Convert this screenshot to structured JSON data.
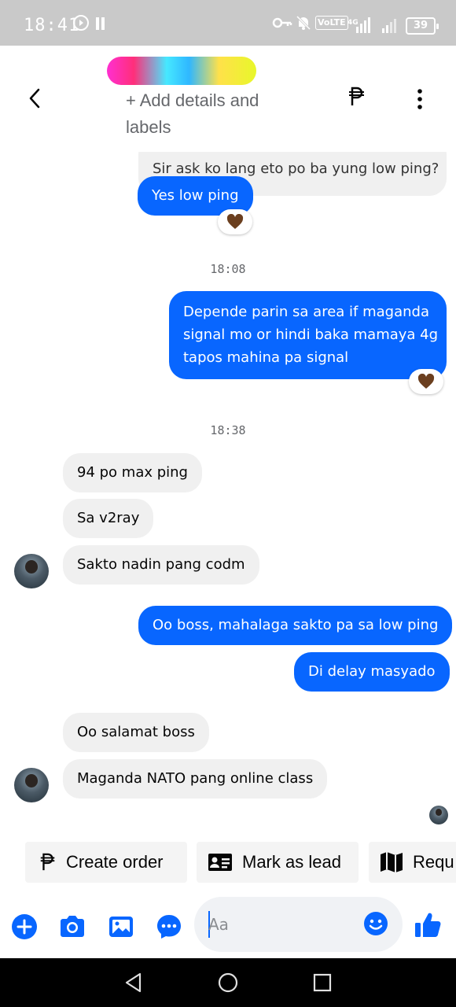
{
  "status_bar": {
    "time": "18:41",
    "volte": "VoLTE",
    "network": "4G",
    "battery": "39"
  },
  "header": {
    "add_details": "+ Add details and labels"
  },
  "messages": {
    "top_partial": "Sir ask ko lang eto po ba yung low ping?",
    "m1": "Yes low ping",
    "ts1": "18:08",
    "m2_line1": "Depende parin sa area if maganda",
    "m2_line2": "signal mo or hindi baka mamaya 4g",
    "m2_line3": "tapos mahina pa signal",
    "ts2": "18:38",
    "m3": "94 po max ping",
    "m4": "Sa v2ray",
    "m5": "Sakto nadin pang codm",
    "m6": "Oo boss, mahalaga sakto pa sa low ping",
    "m7": "Di delay masyado",
    "m8": "Oo salamat boss",
    "m9": "Maganda NATO pang online class"
  },
  "quick_actions": {
    "create_order": "Create order",
    "mark_as_lead": "Mark as lead",
    "request": "Requ"
  },
  "composer": {
    "placeholder": "Aa"
  },
  "colors": {
    "accent": "#0866ff",
    "incoming_bubble": "#f0f0f0",
    "reaction": "#6b3f1f"
  }
}
